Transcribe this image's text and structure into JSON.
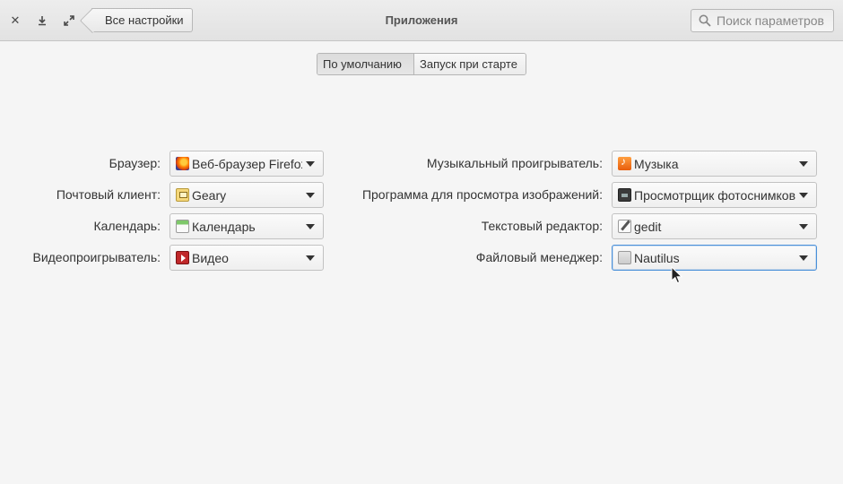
{
  "window": {
    "title": "Приложения",
    "back_label": "Все настройки",
    "search_placeholder": "Поиск параметров"
  },
  "modes": [
    {
      "label": "По умолчанию",
      "active": true
    },
    {
      "label": "Запуск при старте",
      "active": false
    }
  ],
  "left_settings": [
    {
      "label": "Браузер:",
      "value": "Веб-браузер Firefox",
      "icon": "firefox-icon"
    },
    {
      "label": "Почтовый клиент:",
      "value": "Geary",
      "icon": "geary-icon"
    },
    {
      "label": "Календарь:",
      "value": "Календарь",
      "icon": "calendar-icon"
    },
    {
      "label": "Видеопроигрыватель:",
      "value": "Видео",
      "icon": "video-icon"
    }
  ],
  "right_settings": [
    {
      "label": "Музыкальный проигрыватель:",
      "value": "Музыка",
      "icon": "music-icon"
    },
    {
      "label": "Программа для просмотра изображений:",
      "value": "Просмотрщик фотоснимков",
      "icon": "photo-viewer-icon"
    },
    {
      "label": "Текстовый редактор:",
      "value": "gedit",
      "icon": "text-editor-icon"
    },
    {
      "label": "Файловый менеджер:",
      "value": "Nautilus",
      "icon": "folder-icon",
      "focused": true
    }
  ],
  "colors": {
    "background": "#f5f5f5",
    "focus_border": "#4a90d9"
  }
}
